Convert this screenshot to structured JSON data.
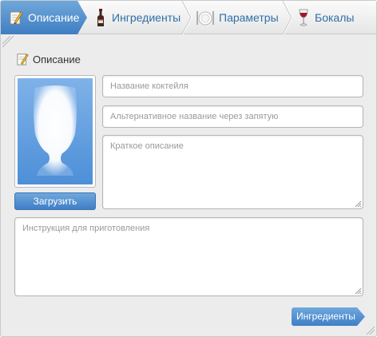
{
  "tabs": [
    {
      "label": "Описание",
      "icon": "pencil-note-icon",
      "active": true
    },
    {
      "label": "Ингредиенты",
      "icon": "bottle-icon",
      "active": false
    },
    {
      "label": "Параметры",
      "icon": "plate-cutlery-icon",
      "active": false
    },
    {
      "label": "Бокалы",
      "icon": "wine-glass-icon",
      "active": false
    }
  ],
  "section": {
    "title": "Описание",
    "icon": "pencil-note-icon"
  },
  "image": {
    "upload_label": "Загрузить",
    "icon": "glass-silhouette-icon"
  },
  "fields": {
    "name_placeholder": "Название коктейля",
    "alt_placeholder": "Альтернативное название через запятую",
    "short_placeholder": "Краткое описание",
    "instructions_placeholder": "Инструкция для приготовления"
  },
  "footer": {
    "next_label": "Ингредиенты"
  },
  "colors": {
    "accent": "#3f7ec3",
    "tab_text": "#2f6fa8",
    "placeholder": "#9a9a9a"
  }
}
